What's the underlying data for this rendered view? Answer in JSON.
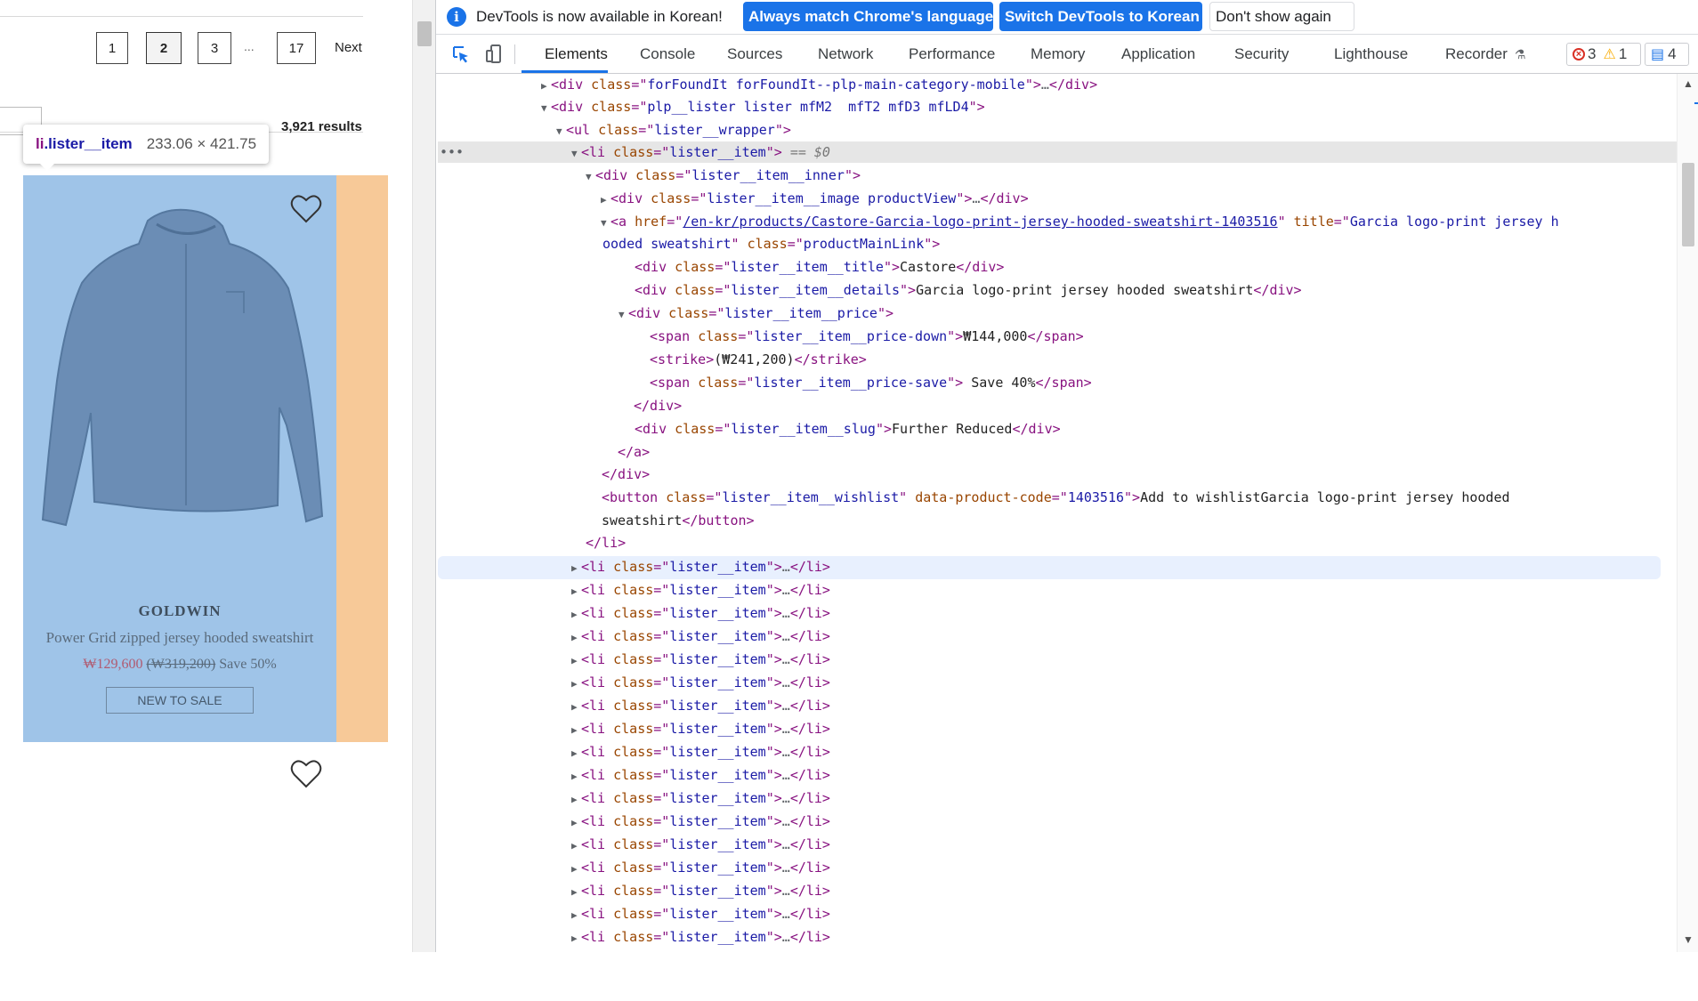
{
  "page": {
    "pagination": {
      "pages": [
        "1",
        "2",
        "3"
      ],
      "active": "2",
      "ellipsis": "...",
      "last": "17",
      "next": "Next"
    },
    "results": "3,921 results",
    "tooltip": {
      "tag": "li",
      "cls": ".lister__item",
      "dims": "233.06 × 421.75"
    },
    "product": {
      "brand": "GOLDWIN",
      "name": "Power Grid zipped jersey hooded sweatshirt",
      "price_down": "₩129,600",
      "price_was": "(₩319,200)",
      "price_save": "Save 50%",
      "slug": "NEW TO SALE"
    }
  },
  "devtools": {
    "infobar": {
      "text": "DevTools is now available in Korean!",
      "btn_match": "Always match Chrome's language",
      "btn_switch": "Switch DevTools to Korean",
      "btn_dismiss": "Don't show again"
    },
    "tabs": [
      "Elements",
      "Console",
      "Sources",
      "Network",
      "Performance",
      "Memory",
      "Application",
      "Security",
      "Lighthouse",
      "Recorder"
    ],
    "active_tab": "Elements",
    "counts": {
      "errors": "3",
      "warnings": "1",
      "messages": "4"
    },
    "dom": {
      "l01_cls": "forFoundIt forFoundIt--plp-main-category-mobile",
      "l02_cls": "plp__lister lister mfM2  mfT2 mfD3 mfLD4",
      "l03_cls": "lister__wrapper",
      "l04_cls": "lister__item",
      "l04_marker": "== $0",
      "l05_cls": "lister__item__inner",
      "l06_cls": "lister__item__image productView",
      "l07_href": "/en-kr/products/Castore-Garcia-logo-print-jersey-hooded-sweatshirt-1403516",
      "l07_title_a": "Garcia logo-print jersey h",
      "l07_title_b": "ooded sweatshirt",
      "l07_cls": "productMainLink",
      "l08_cls": "lister__item__title",
      "l08_text": "Castore",
      "l09_cls": "lister__item__details",
      "l09_text": "Garcia logo-print jersey hooded sweatshirt",
      "l10_cls": "lister__item__price",
      "l11_cls": "lister__item__price-down",
      "l11_text": "₩144,000",
      "l12_text": "(₩241,200)",
      "l13_cls": "lister__item__price-save",
      "l13_text": " Save 40%",
      "l15_cls": "lister__item__slug",
      "l15_text": "Further Reduced",
      "l18_cls": "lister__item__wishlist",
      "l18_code": "1403516",
      "l18_text_a": "Add to wishlistGarcia logo-print jersey hooded",
      "l18_text_b": "sweatshirt",
      "collapsed_item_cls": "lister__item"
    }
  }
}
